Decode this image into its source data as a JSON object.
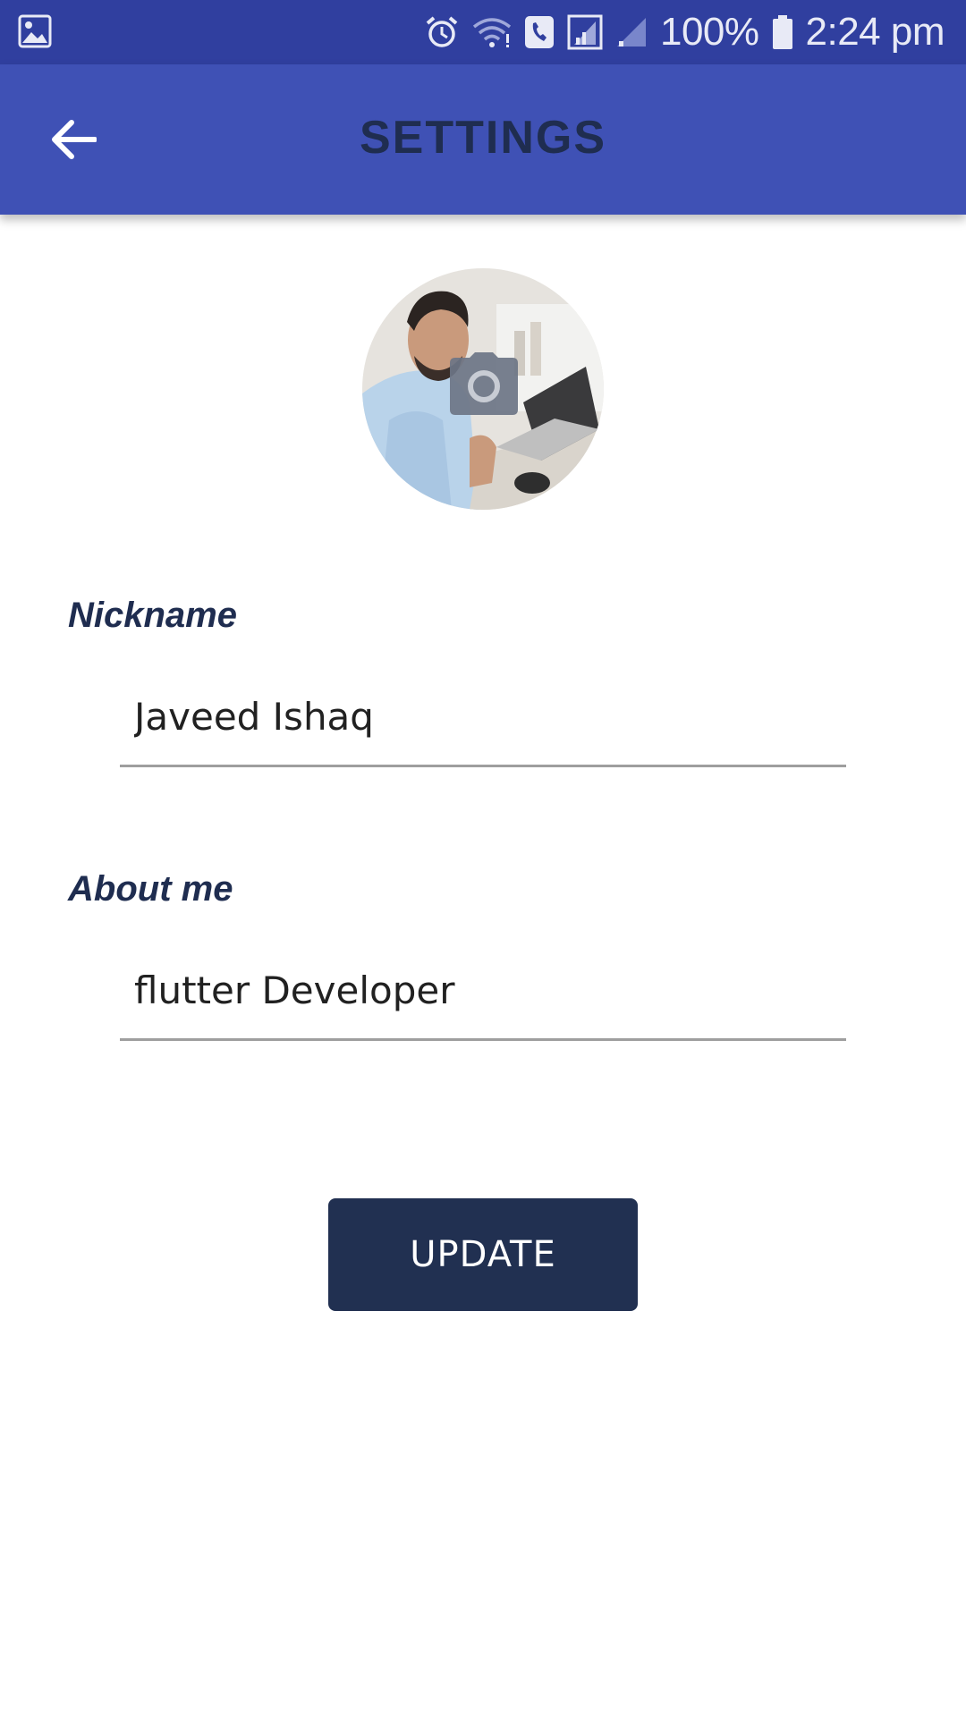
{
  "status_bar": {
    "battery_percent": "100%",
    "time": "2:24 pm",
    "icons": [
      "image-icon",
      "alarm-icon",
      "wifi-icon",
      "call-icon",
      "signal-icon",
      "signal-weak-icon",
      "battery-icon"
    ]
  },
  "app_bar": {
    "title": "SETTINGS",
    "back_icon": "arrow-back-icon"
  },
  "profile": {
    "camera_icon": "camera-icon"
  },
  "form": {
    "nickname_label": "Nickname",
    "nickname_value": "Javeed Ishaq",
    "about_label": "About me",
    "about_value": "flutter Developer",
    "update_label": "UPDATE"
  },
  "colors": {
    "status_bar": "#303f9f",
    "app_bar": "#3f51b5",
    "primary_dark": "#213051",
    "label": "#1f2d50"
  }
}
